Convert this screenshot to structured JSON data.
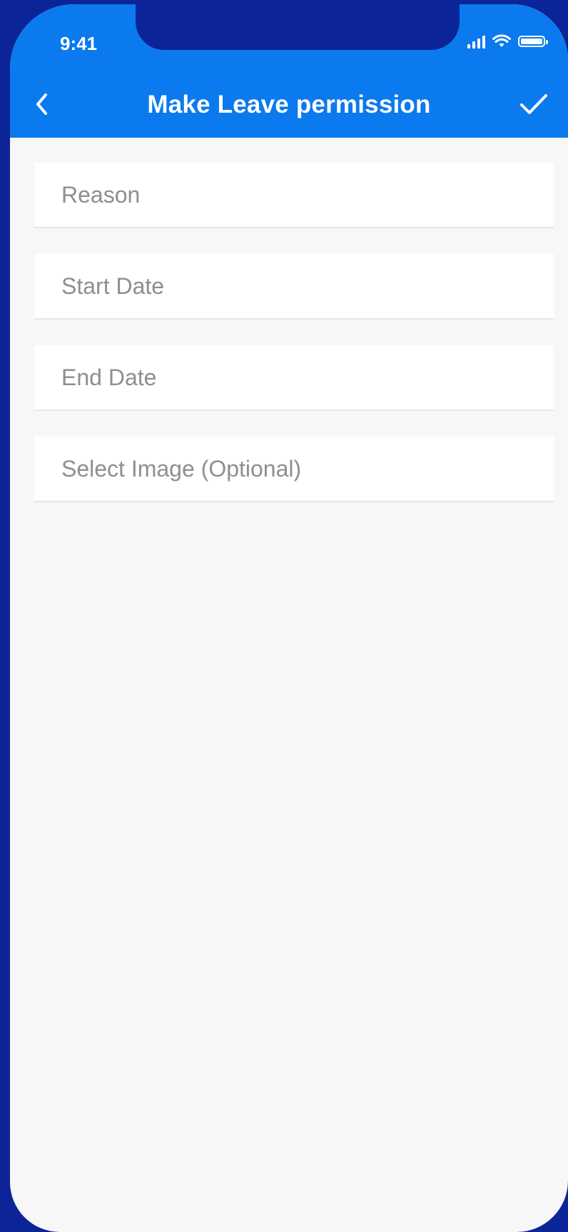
{
  "status_bar": {
    "time": "9:41",
    "icons": [
      "signal-icon",
      "wifi-icon",
      "battery-icon"
    ]
  },
  "nav": {
    "title": "Make Leave permission",
    "back_icon": "chevron-left-icon",
    "confirm_icon": "checkmark-icon"
  },
  "form": {
    "fields": [
      {
        "placeholder": "Reason",
        "value": ""
      },
      {
        "placeholder": "Start Date",
        "value": ""
      },
      {
        "placeholder": "End Date",
        "value": ""
      },
      {
        "placeholder": "Select Image (Optional)",
        "value": ""
      }
    ]
  },
  "colors": {
    "header": "#0a7aee",
    "background": "#f7f7f8",
    "frame": "#0b2497",
    "placeholder": "#8e8e93"
  }
}
